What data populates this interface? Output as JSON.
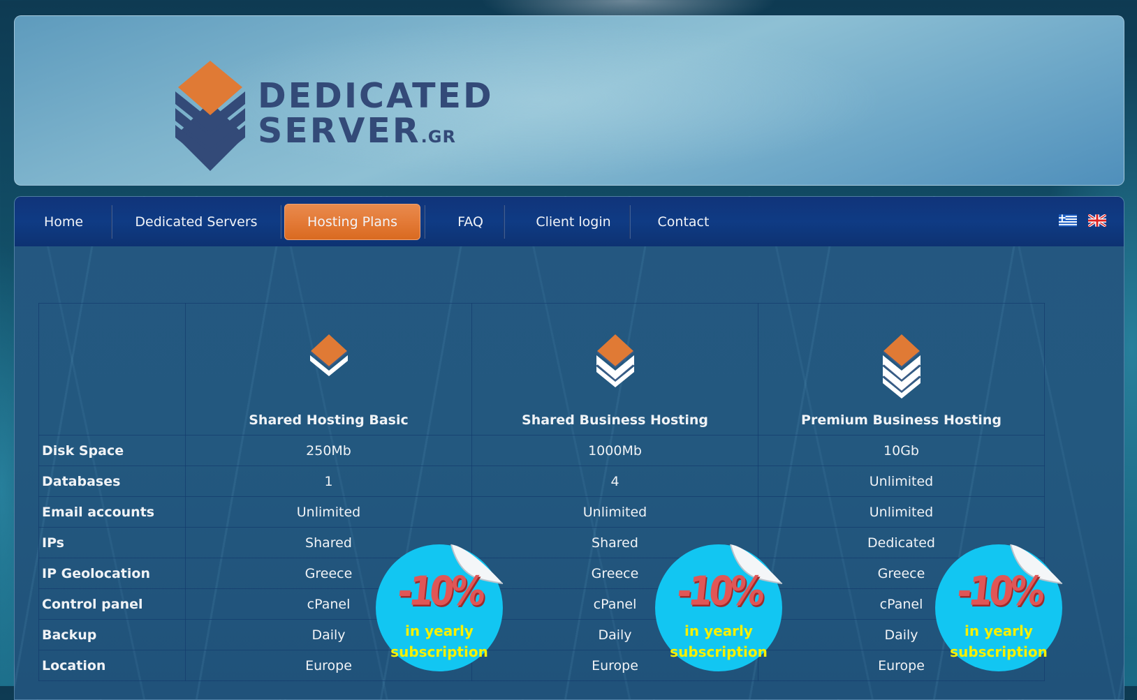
{
  "logo": {
    "line1": "DEDICATED",
    "line2": "SERVER",
    "suffix": ".GR",
    "colors": {
      "orange": "#e07a35",
      "navy": "#334a78"
    }
  },
  "nav": {
    "items": [
      {
        "label": "Home",
        "active": false
      },
      {
        "label": "Dedicated Servers",
        "active": false
      },
      {
        "label": "Hosting Plans",
        "active": true
      },
      {
        "label": "FAQ",
        "active": false
      },
      {
        "label": "Client login",
        "active": false
      },
      {
        "label": "Contact",
        "active": false
      }
    ],
    "languages": [
      {
        "name": "greek-flag-icon",
        "title": "Greek"
      },
      {
        "name": "uk-flag-icon",
        "title": "English"
      }
    ],
    "active_color": "#e37a37"
  },
  "plans": {
    "columns": [
      {
        "title": "Shared Hosting Basic",
        "icon": "server-tier-1-icon",
        "tiers": 1
      },
      {
        "title": "Shared Business Hosting",
        "icon": "server-tier-2-icon",
        "tiers": 2
      },
      {
        "title": "Premium Business Hosting",
        "icon": "server-tier-3-icon",
        "tiers": 3
      }
    ],
    "rows": [
      {
        "label": "Disk Space",
        "values": [
          "250Mb",
          "1000Mb",
          "10Gb"
        ]
      },
      {
        "label": "Databases",
        "values": [
          "1",
          "4",
          "Unlimited"
        ]
      },
      {
        "label": "Email accounts",
        "values": [
          "Unlimited",
          "Unlimited",
          "Unlimited"
        ]
      },
      {
        "label": "IPs",
        "values": [
          "Shared",
          "Shared",
          "Dedicated"
        ]
      },
      {
        "label": "IP Geolocation",
        "values": [
          "Greece",
          "Greece",
          "Greece"
        ]
      },
      {
        "label": "Control panel",
        "values": [
          "cPanel",
          "cPanel",
          "cPanel"
        ]
      },
      {
        "label": "Backup",
        "values": [
          "Daily",
          "Daily",
          "Daily"
        ]
      },
      {
        "label": "Location",
        "values": [
          "Europe",
          "Europe",
          "Europe"
        ]
      }
    ]
  },
  "sticker": {
    "discount": "-10%",
    "line1": "in yearly",
    "line2": "subscription",
    "colors": {
      "circle": "#12c6f2",
      "discount": "#e05656",
      "text": "#f8f000"
    }
  }
}
